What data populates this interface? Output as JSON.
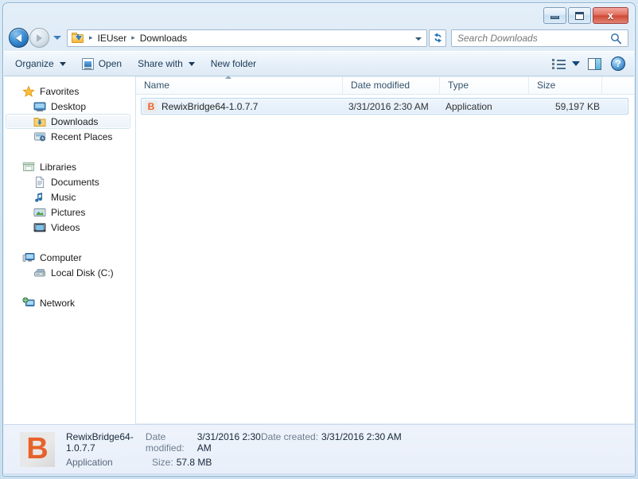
{
  "window": {
    "title": "Downloads",
    "buttons": {
      "minimize": "minimize",
      "maximize": "maximize",
      "close": "x"
    }
  },
  "address_bar": {
    "folder_icon": "downloads-folder-icon",
    "crumbs": [
      "IEUser",
      "Downloads"
    ],
    "separator": "▸",
    "refresh_glyph": "↻"
  },
  "search": {
    "placeholder": "Search Downloads",
    "value": "",
    "icon": "search-icon"
  },
  "toolbar": {
    "organize_label": "Organize",
    "open_label": "Open",
    "share_label": "Share with",
    "new_folder_label": "New folder",
    "view_icon": "view-list-icon",
    "preview_pane_icon": "preview-pane-icon",
    "help_icon": "help-icon",
    "help_glyph": "?"
  },
  "nav_pane": {
    "groups": [
      {
        "header": {
          "label": "Favorites",
          "icon": "star-icon"
        },
        "items": [
          {
            "label": "Desktop",
            "icon": "desktop-icon",
            "selected": false
          },
          {
            "label": "Downloads",
            "icon": "downloads-folder-icon",
            "selected": true
          },
          {
            "label": "Recent Places",
            "icon": "recent-places-icon",
            "selected": false
          }
        ]
      },
      {
        "header": {
          "label": "Libraries",
          "icon": "libraries-icon"
        },
        "items": [
          {
            "label": "Documents",
            "icon": "documents-icon",
            "selected": false
          },
          {
            "label": "Music",
            "icon": "music-note-icon",
            "selected": false
          },
          {
            "label": "Pictures",
            "icon": "pictures-icon",
            "selected": false
          },
          {
            "label": "Videos",
            "icon": "videos-icon",
            "selected": false
          }
        ]
      },
      {
        "header": {
          "label": "Computer",
          "icon": "computer-icon"
        },
        "items": [
          {
            "label": "Local Disk (C:)",
            "icon": "hard-drive-icon",
            "selected": false
          }
        ]
      },
      {
        "header": {
          "label": "Network",
          "icon": "network-icon"
        },
        "items": []
      }
    ]
  },
  "file_list": {
    "columns": [
      {
        "key": "name",
        "label": "Name",
        "sorted": "asc"
      },
      {
        "key": "date",
        "label": "Date modified",
        "sorted": ""
      },
      {
        "key": "type",
        "label": "Type",
        "sorted": ""
      },
      {
        "key": "size",
        "label": "Size",
        "sorted": ""
      }
    ],
    "rows": [
      {
        "name": "RewixBridge64-1.0.7.7",
        "date": "3/31/2016 2:30 AM",
        "type": "Application",
        "size": "59,197 KB",
        "icon": "b-application-icon",
        "icon_letter": "B",
        "selected": true
      }
    ]
  },
  "details_pane": {
    "icon": "b-application-icon",
    "icon_letter": "B",
    "file_name": "RewixBridge64-1.0.7.7",
    "file_type": "Application",
    "date_modified_label": "Date modified:",
    "date_modified_value": "3/31/2016 2:30 AM",
    "size_label": "Size:",
    "size_value": "57.8 MB",
    "date_created_label": "Date created:",
    "date_created_value": "3/31/2016 2:30 AM"
  },
  "colors": {
    "accent_orange": "#e8622a",
    "selection_blue": "#e2eefa",
    "frame_blue": "#cddff0",
    "border_blue": "#8ab4d4"
  }
}
